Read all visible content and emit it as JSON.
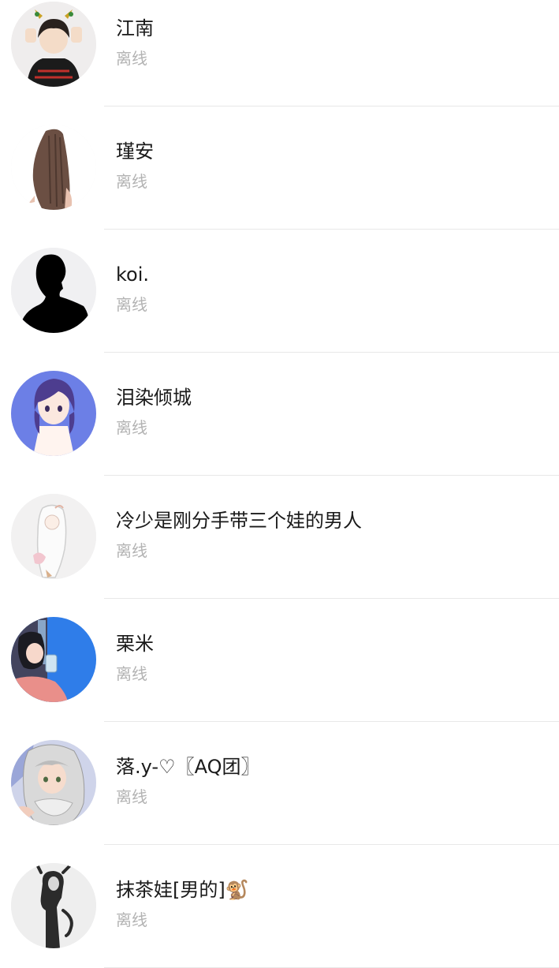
{
  "contacts": [
    {
      "name": "江南",
      "status": "离线",
      "avatar_icon": "avatar-dark-hair-horns-icon"
    },
    {
      "name": "瑾安",
      "status": "离线",
      "avatar_icon": "avatar-long-brown-hair-icon"
    },
    {
      "name": "koi.",
      "status": "离线",
      "avatar_icon": "avatar-black-silhouette-icon"
    },
    {
      "name": "泪染倾城",
      "status": "离线",
      "avatar_icon": "avatar-purple-hair-girl-icon"
    },
    {
      "name": "冷少是刚分手带三个娃的男人",
      "status": "离线",
      "avatar_icon": "avatar-white-hair-sketch-icon"
    },
    {
      "name": "栗米",
      "status": "离线",
      "avatar_icon": "avatar-girl-blue-background-icon"
    },
    {
      "name": "落.y-♡〖AQ团〗",
      "status": "离线",
      "avatar_icon": "avatar-silver-hair-girl-icon"
    },
    {
      "name": "抹茶娃[男的]🐒",
      "status": "离线",
      "avatar_icon": "avatar-monochrome-girl-icon"
    }
  ],
  "colors": {
    "name_text": "#1a1a1a",
    "status_text": "#b3b3b3",
    "divider": "#e8e8e8",
    "background": "#ffffff"
  }
}
